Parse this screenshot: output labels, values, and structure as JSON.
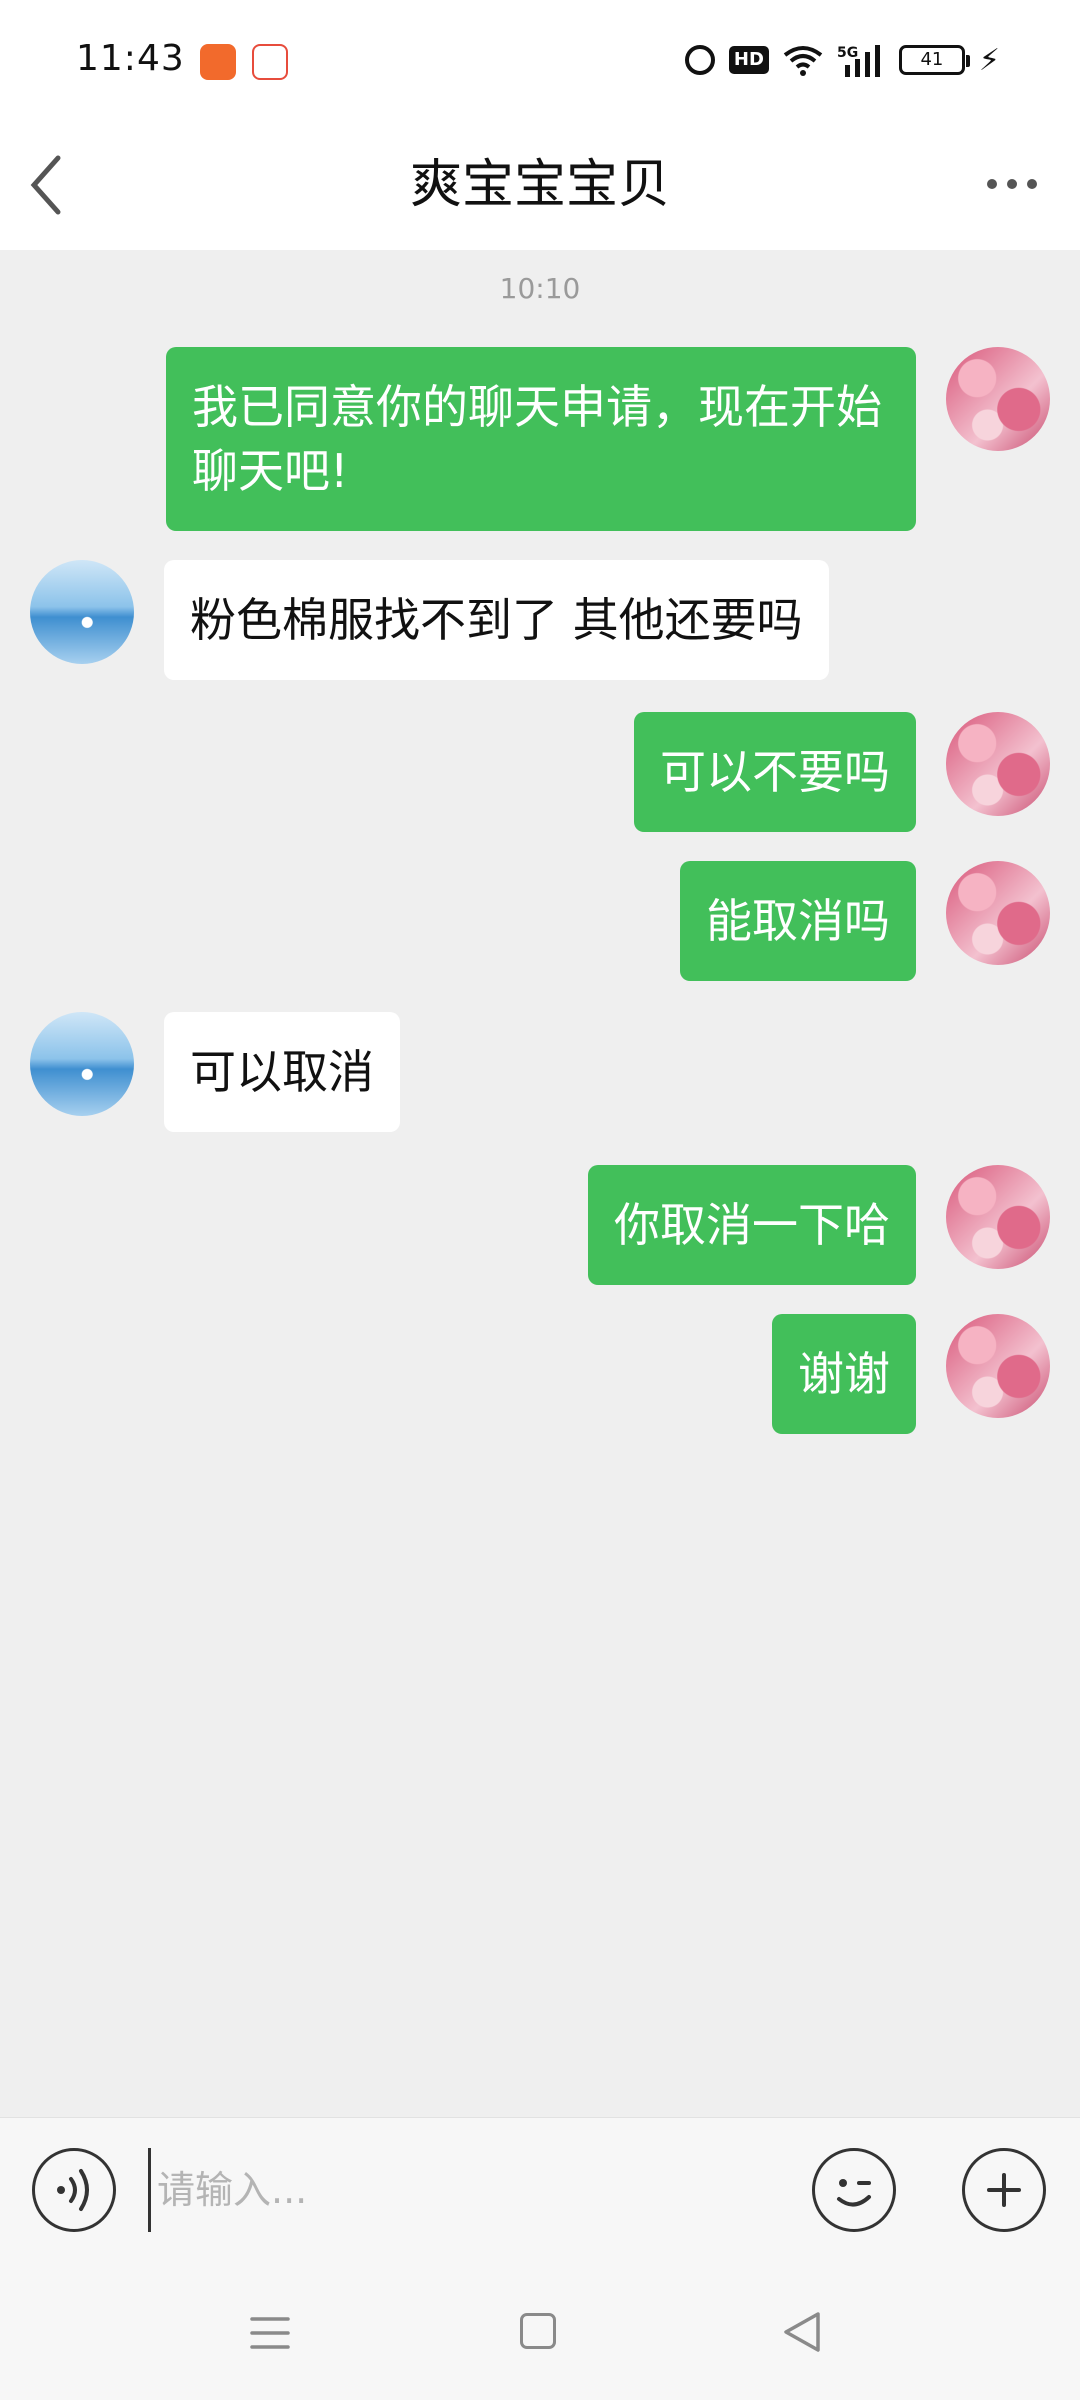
{
  "status_bar": {
    "time": "11:43",
    "apps": [
      "haohaojia-app-icon",
      "58-app-icon"
    ],
    "icons": [
      "alarm-icon",
      "hd-icon",
      "wifi-icon",
      "5g-signal-icon",
      "battery-icon",
      "charging-icon"
    ],
    "hd_label": "HD",
    "battery_level": "41"
  },
  "header": {
    "title": "爽宝宝宝贝"
  },
  "chat": {
    "timestamp": "10:10",
    "messages": [
      {
        "from": "self",
        "text": "我已同意你的聊天申请，现在开始聊天吧!"
      },
      {
        "from": "peer",
        "text": "粉色棉服找不到了 其他还要吗"
      },
      {
        "from": "self",
        "text": "可以不要吗"
      },
      {
        "from": "self",
        "text": "能取消吗"
      },
      {
        "from": "peer",
        "text": "可以取消"
      },
      {
        "from": "self",
        "text": "你取消一下哈"
      },
      {
        "from": "self",
        "text": "谢谢"
      }
    ]
  },
  "input": {
    "placeholder": "请输入..."
  },
  "colors": {
    "self_bubble": "#42bf5a",
    "peer_bubble": "#ffffff",
    "background": "#efefef"
  }
}
